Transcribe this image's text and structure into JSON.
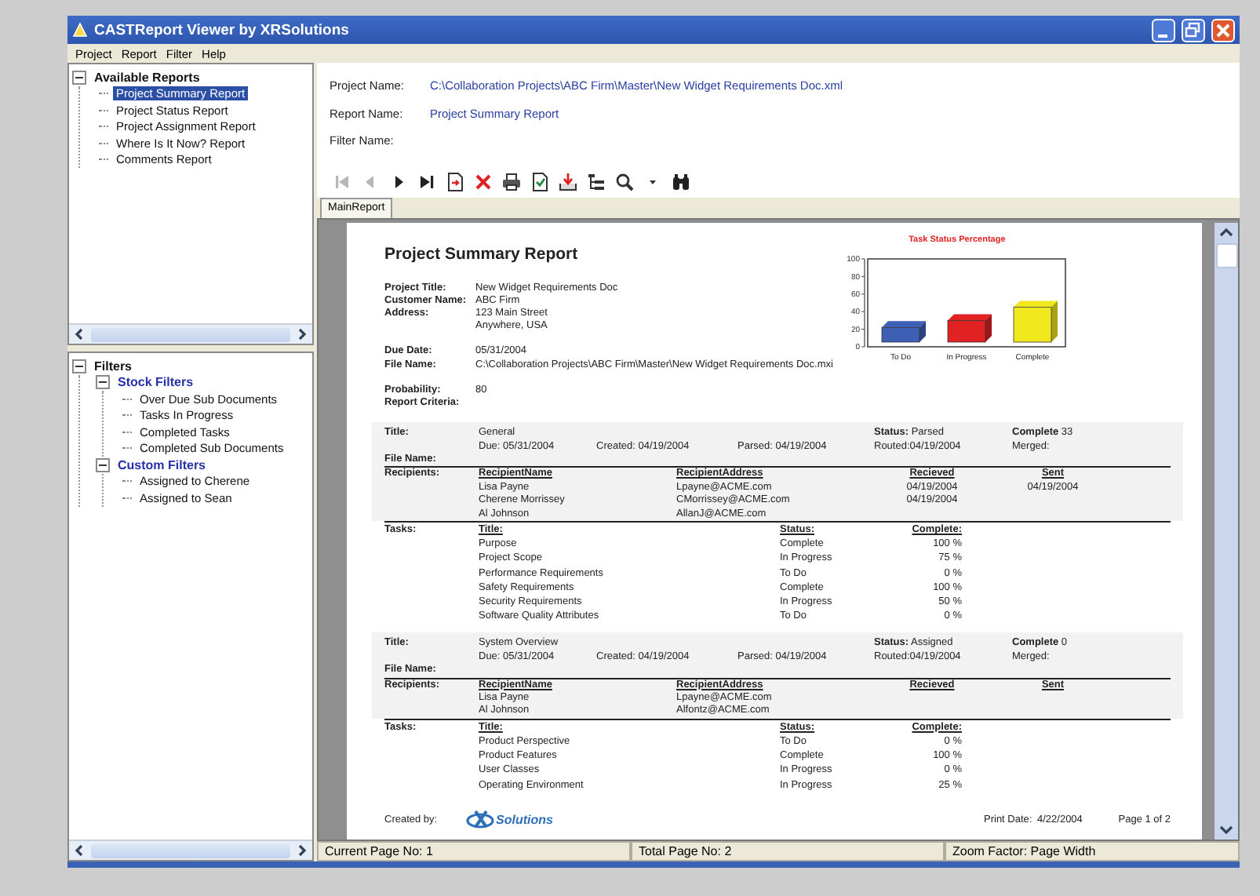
{
  "window": {
    "title": "CASTReport Viewer by XRSolutions"
  },
  "menu": [
    "Project",
    "Report",
    "Filter",
    "Help"
  ],
  "reports_tree": [
    {
      "label": "Available Reports",
      "kind": "root",
      "expanded": true,
      "selected": false,
      "children": [
        {
          "label": "Project Summary Report",
          "kind": "item",
          "selected": true
        },
        {
          "label": "Project Status Report",
          "kind": "item",
          "selected": false
        },
        {
          "label": "Project Assignment Report",
          "kind": "item",
          "selected": false
        },
        {
          "label": "Where Is It Now? Report",
          "kind": "item",
          "selected": false
        },
        {
          "label": "Comments Report",
          "kind": "item",
          "selected": false
        }
      ]
    }
  ],
  "filters_tree": [
    {
      "label": "Filters",
      "kind": "root",
      "expanded": true,
      "selected": false,
      "children": [
        {
          "label": "Stock Filters",
          "kind": "group",
          "expanded": true,
          "selected": false,
          "children": [
            {
              "label": "Over Due Sub Documents",
              "kind": "item",
              "selected": false
            },
            {
              "label": "Tasks In Progress",
              "kind": "item",
              "selected": false
            },
            {
              "label": "Completed Tasks",
              "kind": "item",
              "selected": false
            },
            {
              "label": "Completed Sub Documents",
              "kind": "item",
              "selected": false
            }
          ]
        },
        {
          "label": "Custom Filters",
          "kind": "group",
          "expanded": true,
          "selected": false,
          "children": [
            {
              "label": "Assigned to Cherene",
              "kind": "item",
              "selected": false
            },
            {
              "label": "Assigned to Sean",
              "kind": "item",
              "selected": false
            }
          ]
        }
      ]
    }
  ],
  "header_fields": [
    {
      "label": "Project Name:",
      "value": "C:\\Collaboration Projects\\ABC Firm\\Master\\New Widget Requirements Doc.xml"
    },
    {
      "label": "Report Name:",
      "value": "Project Summary Report"
    },
    {
      "label": "Filter Name:"
    }
  ],
  "toolbar": [
    {
      "kind": "first",
      "disabled": true
    },
    {
      "kind": "previous",
      "disabled": true
    },
    {
      "kind": "next",
      "disabled": false
    },
    {
      "kind": "last",
      "disabled": false
    },
    {
      "kind": "goto",
      "disabled": false
    },
    {
      "kind": "close",
      "disabled": false
    },
    {
      "kind": "print",
      "disabled": false
    },
    {
      "kind": "refresh",
      "disabled": false
    },
    {
      "kind": "export",
      "disabled": false
    },
    {
      "kind": "tree",
      "disabled": false
    },
    {
      "kind": "zoom",
      "disabled": false
    },
    {
      "kind": "dropdown",
      "disabled": false
    },
    {
      "kind": "find",
      "disabled": false
    }
  ],
  "tabs": [
    {
      "label": "MainReport",
      "selected": true
    }
  ],
  "report": {
    "title": "Project Summary Report",
    "info_groups": [
      [
        {
          "label": "Project Title:",
          "lines": [
            "New Widget Requirements Doc"
          ]
        },
        {
          "label": "Customer Name:",
          "lines": [
            "ABC Firm"
          ]
        },
        {
          "label": "Address:",
          "lines": [
            "123 Main Street",
            "Anywhere, USA"
          ]
        }
      ],
      [
        {
          "label": "Due Date:",
          "lines": [
            "05/31/2004"
          ]
        },
        {
          "label": "File Name:",
          "lines": [
            "C:\\Collaboration Projects\\ABC Firm\\Master\\New Widget Requirements Doc.mxi"
          ]
        }
      ],
      [
        {
          "label": "Probability:",
          "lines": [
            "80"
          ]
        },
        {
          "label": "Report Criteria:"
        }
      ]
    ],
    "chart_data": {
      "type": "bar",
      "title": "Task Status Percentage",
      "categories": [
        "To Do",
        "In Progress",
        "Complete"
      ],
      "ylim": [
        0,
        100
      ],
      "yticks": [
        0,
        20,
        40,
        60,
        80,
        100
      ],
      "series": [
        {
          "color": "#3d5fb5",
          "values": [
            22,
            null,
            null
          ]
        },
        {
          "color": "#e02222",
          "values": [
            null,
            30,
            null
          ]
        },
        {
          "color": "#f2e81e",
          "values": [
            null,
            null,
            45
          ]
        }
      ]
    },
    "documents": [
      {
        "labels": {
          "title": "Title:",
          "file_name": "File Name:",
          "recipients": "Recipients:",
          "tasks": "Tasks:"
        },
        "title": "General",
        "status": "**Status:** Parsed",
        "complete": "**Complete** 33",
        "due": "Due: 05/31/2004",
        "created": "Created: 04/19/2004",
        "parsed": "Parsed: 04/19/2004",
        "routed": "Routed:04/19/2004",
        "merged": "Merged:",
        "recipient_columns": [
          "RecipientName",
          "RecipientAddress",
          "Recieved",
          "Sent"
        ],
        "recipients": [
          {
            "name": "Lisa Payne",
            "address": "Lpayne@ACME.com",
            "received": "04/19/2004",
            "sent": "04/19/2004"
          },
          {
            "name": "Cherene Morrissey",
            "address": "CMorrissey@ACME.com",
            "received": "04/19/2004"
          },
          {
            "name": "Al Johnson",
            "address": "AllanJ@ACME.com"
          }
        ],
        "task_columns": [
          "Title:",
          "Status:",
          "Complete:"
        ],
        "tasks": [
          {
            "title": "Purpose",
            "status": "Complete",
            "complete": "100 %"
          },
          {
            "title": "Project Scope",
            "status": "In Progress",
            "complete": "75 %"
          },
          {
            "title": "Performance Requirements",
            "status": "To Do",
            "complete": "0 %"
          },
          {
            "title": "Safety Requirements",
            "status": "Complete",
            "complete": "100 %"
          },
          {
            "title": "Security Requirements",
            "status": "In Progress",
            "complete": "50 %"
          },
          {
            "title": "Software Quality Attributes",
            "status": "To Do",
            "complete": "0 %"
          }
        ]
      },
      {
        "labels": {
          "title": "Title:",
          "file_name": "File Name:",
          "recipients": "Recipients:",
          "tasks": "Tasks:"
        },
        "title": "System Overview",
        "status": "**Status:** Assigned",
        "complete": "**Complete** 0",
        "due": "Due: 05/31/2004",
        "created": "Created: 04/19/2004",
        "parsed": "Parsed: 04/19/2004",
        "routed": "Routed:04/19/2004",
        "merged": "Merged:",
        "recipient_columns": [
          "RecipientName",
          "RecipientAddress",
          "Recieved",
          "Sent"
        ],
        "recipients": [
          {
            "name": "Lisa Payne",
            "address": "Lpayne@ACME.com"
          },
          {
            "name": "Al Johnson",
            "address": "Alfontz@ACME.com"
          }
        ],
        "task_columns": [
          "Title:",
          "Status:",
          "Complete:"
        ],
        "tasks": [
          {
            "title": "Product Perspective",
            "status": "To Do",
            "complete": "0 %"
          },
          {
            "title": "Product Features",
            "status": "Complete",
            "complete": "100 %"
          },
          {
            "title": "User Classes",
            "status": "In Progress",
            "complete": "0 %"
          },
          {
            "title": "Operating Environment",
            "status": "In Progress",
            "complete": "25 %"
          }
        ]
      }
    ],
    "footer": {
      "created_by": "Created by:",
      "logo_text": "Solutions",
      "print_date_label": "Print Date:",
      "print_date": "4/22/2004",
      "page": "Page 1 of 2"
    }
  },
  "status_bar": [
    "Current Page No: 1",
    "Total Page No: 2",
    "Zoom Factor: Page Width"
  ]
}
